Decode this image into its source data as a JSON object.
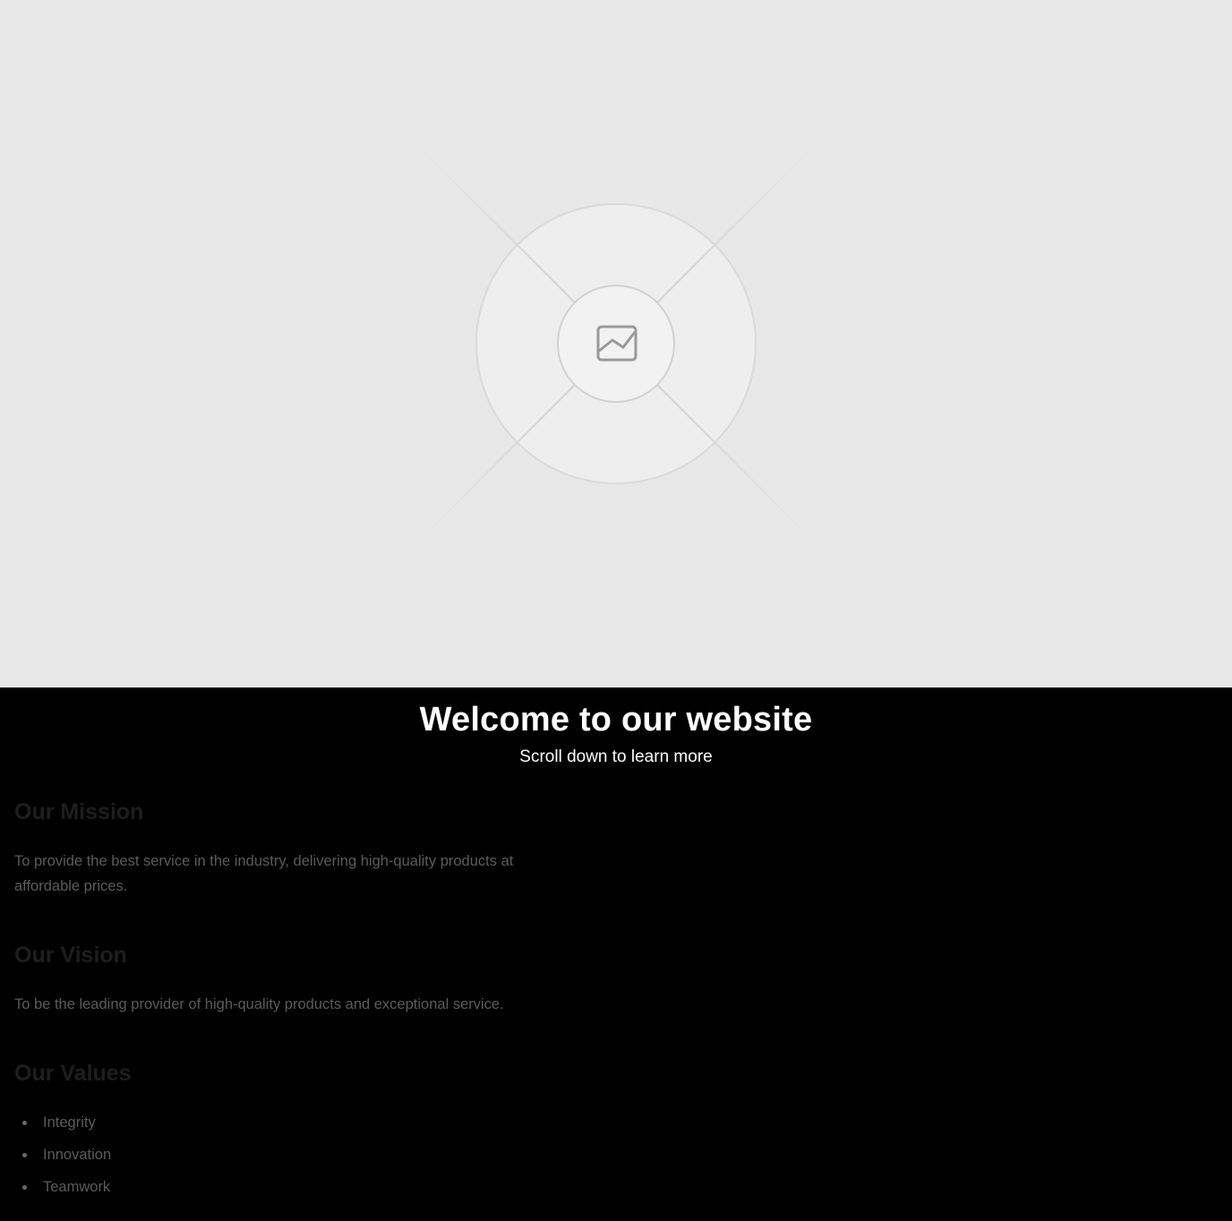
{
  "hero": {
    "icon": "image-placeholder-icon",
    "background_color": "#e8e8e8"
  },
  "welcome": {
    "title": "Welcome to our website",
    "subtitle": "Scroll down to learn more"
  },
  "mission": {
    "heading": "Our Mission",
    "text": "To provide the best service in the industry, delivering high-quality products at affordable prices."
  },
  "vision": {
    "heading": "Our Vision",
    "text": "To be the leading provider of high-quality products and exceptional service."
  },
  "values": {
    "heading": "Our Values",
    "items": [
      "Integrity",
      "Innovation",
      "Teamwork"
    ]
  },
  "colors": {
    "page_background": "#000000",
    "heading_text": "#ffffff",
    "section_heading": "#1e1e1e",
    "body_text": "#5b5b5b"
  }
}
